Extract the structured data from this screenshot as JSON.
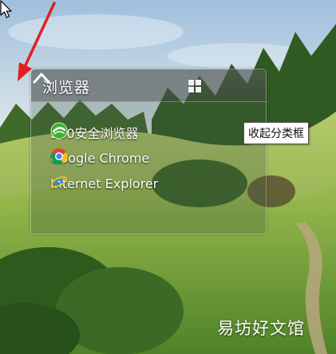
{
  "fence": {
    "title": "浏览器",
    "layout_button_icon": "grid-icon",
    "collapse_button_icon": "chevron-up-icon",
    "items": [
      {
        "label": "360安全浏览器",
        "icon": "360-browser-icon"
      },
      {
        "label": "Google Chrome",
        "icon": "chrome-icon"
      },
      {
        "label": "Internet Explorer",
        "icon": "internet-explorer-icon"
      }
    ]
  },
  "tooltip": {
    "text": "收起分类框"
  },
  "annotation": {
    "color": "#e02020",
    "icon": "red-arrow-icon"
  },
  "watermark": {
    "text": "易坊好文馆"
  }
}
